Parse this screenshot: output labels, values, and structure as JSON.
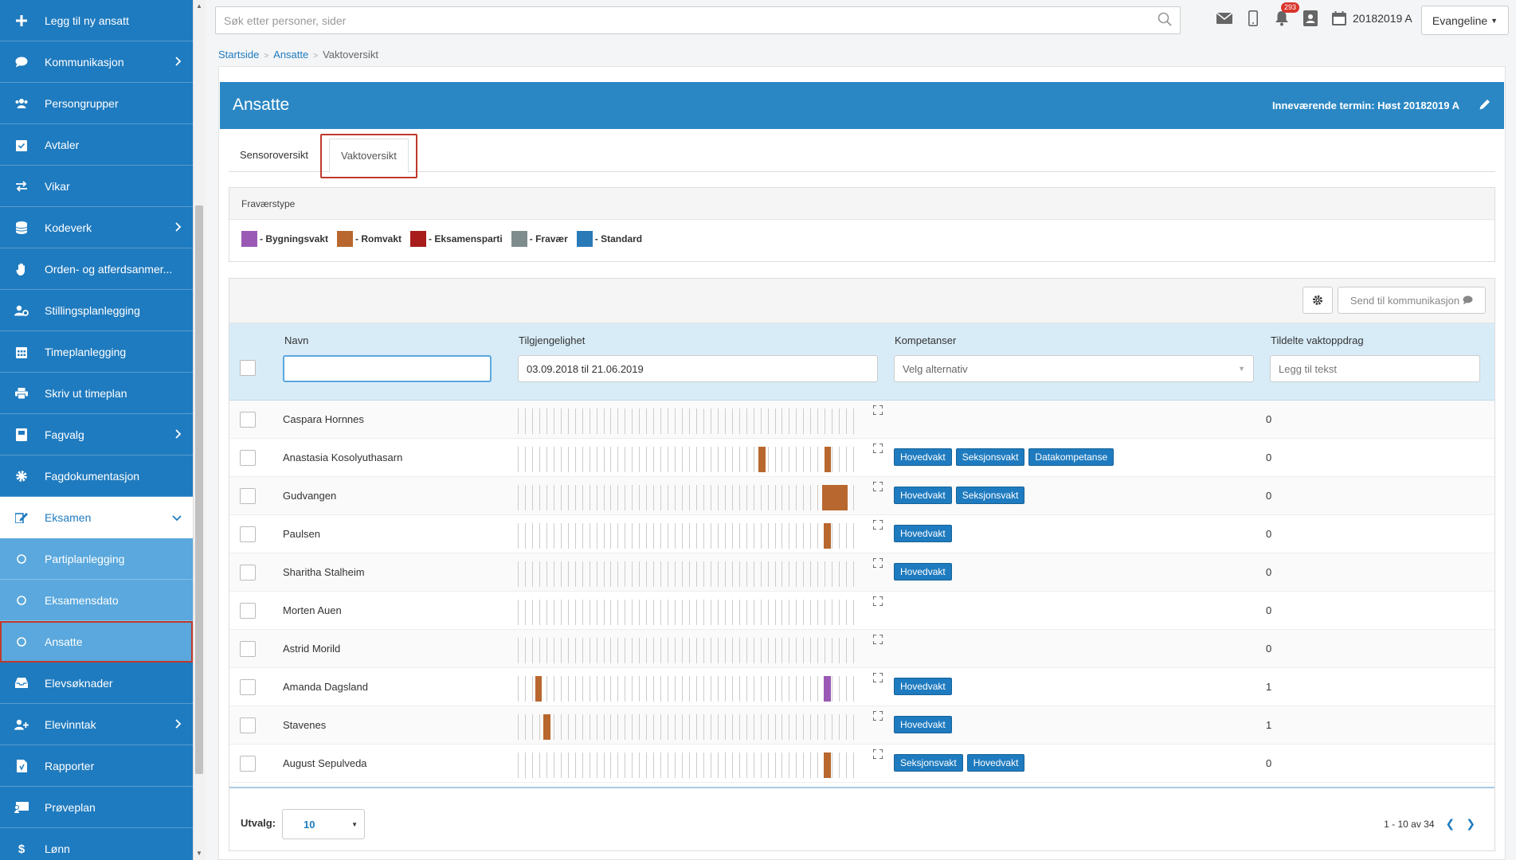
{
  "sidebar": {
    "items": [
      {
        "label": "Legg til ny ansatt",
        "icon": "plus-icon",
        "chevron": false,
        "state": "normal"
      },
      {
        "label": "Kommunikasjon",
        "icon": "chat-icon",
        "chevron": true,
        "state": "normal"
      },
      {
        "label": "Persongrupper",
        "icon": "users-icon",
        "chevron": false,
        "state": "normal"
      },
      {
        "label": "Avtaler",
        "icon": "calendar-check-icon",
        "chevron": false,
        "state": "normal"
      },
      {
        "label": "Vikar",
        "icon": "swap-icon",
        "chevron": false,
        "state": "normal"
      },
      {
        "label": "Kodeverk",
        "icon": "database-icon",
        "chevron": true,
        "state": "normal"
      },
      {
        "label": "Orden- og atferdsanmer...",
        "icon": "hand-icon",
        "chevron": false,
        "state": "normal"
      },
      {
        "label": "Stillingsplanlegging",
        "icon": "user-cog-icon",
        "chevron": false,
        "state": "normal"
      },
      {
        "label": "Timeplanlegging",
        "icon": "calendar-grid-icon",
        "chevron": false,
        "state": "normal"
      },
      {
        "label": "Skriv ut timeplan",
        "icon": "printer-icon",
        "chevron": false,
        "state": "normal"
      },
      {
        "label": "Fagvalg",
        "icon": "book-icon",
        "chevron": true,
        "state": "normal"
      },
      {
        "label": "Fagdokumentasjon",
        "icon": "gear-icon",
        "chevron": false,
        "state": "normal"
      },
      {
        "label": "Eksamen",
        "icon": "pencil-note-icon",
        "chevron": true,
        "state": "active-parent"
      },
      {
        "label": "Partiplanlegging",
        "icon": "circle-icon",
        "chevron": false,
        "state": "sub"
      },
      {
        "label": "Eksamensdato",
        "icon": "circle-icon",
        "chevron": false,
        "state": "sub"
      },
      {
        "label": "Ansatte",
        "icon": "circle-icon",
        "chevron": false,
        "state": "sub-selected"
      },
      {
        "label": "Elevsøknader",
        "icon": "inbox-icon",
        "chevron": false,
        "state": "normal"
      },
      {
        "label": "Elevinntak",
        "icon": "user-plus-icon",
        "chevron": true,
        "state": "normal"
      },
      {
        "label": "Rapporter",
        "icon": "report-icon",
        "chevron": false,
        "state": "normal"
      },
      {
        "label": "Prøveplan",
        "icon": "chalkboard-icon",
        "chevron": false,
        "state": "normal"
      },
      {
        "label": "Lønn",
        "icon": "dollar-icon",
        "chevron": false,
        "state": "normal"
      }
    ]
  },
  "topbar": {
    "search_placeholder": "Søk etter personer, sider",
    "notification_count": "293",
    "term": "20182019 A",
    "user": "Evangeline"
  },
  "breadcrumb": {
    "home": "Startside",
    "section": "Ansatte",
    "current": "Vaktoversikt"
  },
  "header": {
    "title": "Ansatte",
    "term": "Inneværende termin: Høst 20182019 A"
  },
  "tabs": [
    {
      "label": "Sensoroversikt"
    },
    {
      "label": "Vaktoversikt"
    }
  ],
  "legend": {
    "title": "Fraværstype",
    "items": [
      {
        "label": "- Bygningsvakt",
        "color": "#9b59b6"
      },
      {
        "label": "- Romvakt",
        "color": "#b8672e"
      },
      {
        "label": "- Eksamensparti",
        "color": "#a81c1c"
      },
      {
        "label": "- Fravær",
        "color": "#7f8c8d"
      },
      {
        "label": "- Standard",
        "color": "#2a7ab8"
      }
    ]
  },
  "grid": {
    "send_label": "Send til kommunikasjon",
    "columns": {
      "name": "Navn",
      "availability": "Tilgjengelighet",
      "competence": "Kompetanser",
      "assigned": "Tildelte vaktoppdrag"
    },
    "filters": {
      "name_value": "",
      "availability_value": "03.09.2018 til 21.06.2019",
      "competence_placeholder": "Velg alternativ",
      "assigned_placeholder": "Legg til tekst"
    },
    "rows": [
      {
        "name": "Caspara Hornnes",
        "tags": [],
        "count": "0",
        "bars": []
      },
      {
        "name": "Anastasia Kosolyuthasarn",
        "tags": [
          "Hovedvakt",
          "Seksjonsvakt",
          "Datakompetanse"
        ],
        "count": "0",
        "bars": [
          {
            "start": 0.703,
            "width": 0.02,
            "type": "romvakt"
          },
          {
            "start": 0.895,
            "width": 0.02,
            "type": "romvakt"
          }
        ]
      },
      {
        "name": "Gudvangen",
        "tags": [
          "Hovedvakt",
          "Seksjonsvakt"
        ],
        "count": "0",
        "bars": [
          {
            "start": 0.888,
            "width": 0.075,
            "type": "romvakt"
          }
        ]
      },
      {
        "name": "Paulsen",
        "tags": [
          "Hovedvakt"
        ],
        "count": "0",
        "bars": [
          {
            "start": 0.893,
            "width": 0.02,
            "type": "romvakt"
          }
        ]
      },
      {
        "name": "Sharitha Stalheim",
        "tags": [
          "Hovedvakt"
        ],
        "count": "0",
        "bars": []
      },
      {
        "name": "Morten Auen",
        "tags": [],
        "count": "0",
        "bars": []
      },
      {
        "name": "Astrid Morild",
        "tags": [],
        "count": "0",
        "bars": []
      },
      {
        "name": "Amanda Dagsland",
        "tags": [
          "Hovedvakt"
        ],
        "count": "1",
        "bars": [
          {
            "start": 0.05,
            "width": 0.02,
            "type": "romvakt"
          },
          {
            "start": 0.893,
            "width": 0.02,
            "type": "bygningsvakt"
          }
        ]
      },
      {
        "name": "Stavenes",
        "tags": [
          "Hovedvakt"
        ],
        "count": "1",
        "bars": [
          {
            "start": 0.074,
            "width": 0.022,
            "type": "romvakt"
          }
        ]
      },
      {
        "name": "August Sepulveda",
        "tags": [
          "Seksjonsvakt",
          "Hovedvakt"
        ],
        "count": "0",
        "bars": [
          {
            "start": 0.893,
            "width": 0.02,
            "type": "romvakt"
          }
        ]
      }
    ]
  },
  "footer": {
    "page_size_label": "Utvalg:",
    "page_size": "10",
    "range": "1 - 10 av 34"
  }
}
